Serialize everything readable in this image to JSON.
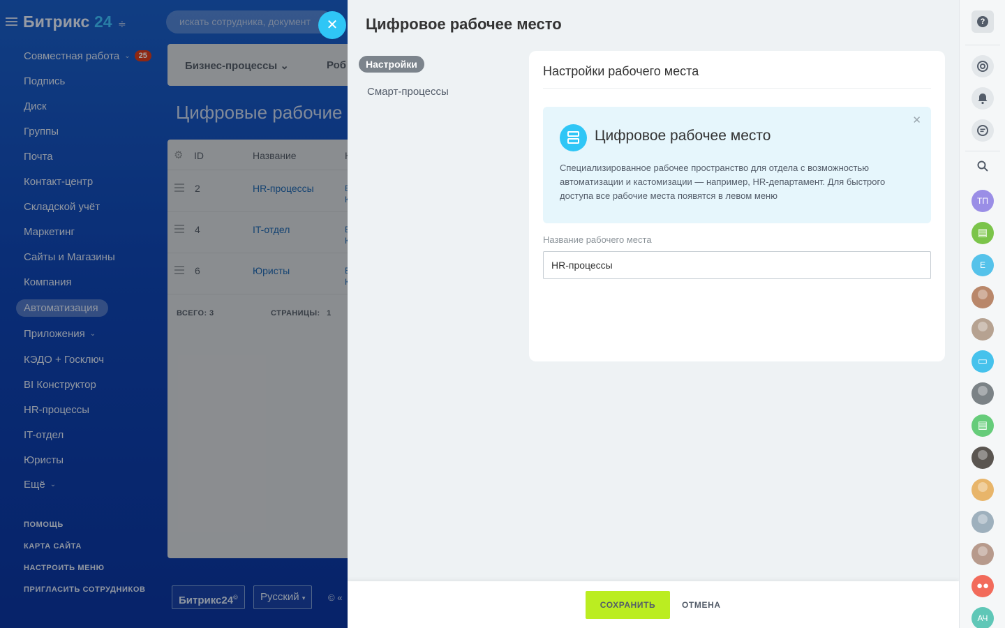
{
  "app": {
    "logo_text": "Битрикс",
    "logo_number": "24",
    "search_placeholder": "искать сотрудника, документ"
  },
  "sidebar": {
    "items": [
      {
        "label": "Совместная работа",
        "badge": "25",
        "chevron": true
      },
      {
        "label": "Подпись"
      },
      {
        "label": "Диск"
      },
      {
        "label": "Группы"
      },
      {
        "label": "Почта"
      },
      {
        "label": "Контакт-центр"
      },
      {
        "label": "Складской учёт"
      },
      {
        "label": "Маркетинг"
      },
      {
        "label": "Сайты и Магазины"
      },
      {
        "label": "Компания"
      },
      {
        "label": "Автоматизация",
        "active": true
      },
      {
        "label": "Приложения",
        "chevron": true
      },
      {
        "label": "КЭДО + Госключ"
      },
      {
        "label": "BI Конструктор"
      },
      {
        "label": "HR-процессы"
      },
      {
        "label": "IT-отдел"
      },
      {
        "label": "Юристы"
      },
      {
        "label": "Ещё",
        "chevron": true
      }
    ],
    "footer_links": [
      "ПОМОЩЬ",
      "КАРТА САЙТА",
      "НАСТРОИТЬ МЕНЮ",
      "ПРИГЛАСИТЬ СОТРУДНИКОВ"
    ]
  },
  "background_page": {
    "top_tabs": [
      "Бизнес-процессы",
      "Роб"
    ],
    "title": "Цифровые рабочие м",
    "table": {
      "headers": [
        "ID",
        "Название",
        "К"
      ],
      "rows": [
        {
          "id": "2",
          "name": "HR-процессы",
          "extra": "Е\nК"
        },
        {
          "id": "4",
          "name": "IT-отдел",
          "extra": "Е\nК"
        },
        {
          "id": "6",
          "name": "Юристы",
          "extra": "Е\nК"
        }
      ],
      "total_label": "ВСЕГО:",
      "total_value": "3",
      "pages_label": "СТРАНИЦЫ:",
      "pages_value": "1"
    },
    "footer_logo": "Битрикс24",
    "footer_lang": "Русский",
    "footer_copy": "© «"
  },
  "slider": {
    "title": "Цифровое рабочее место",
    "menu": [
      "Настройки",
      "Смарт-процессы"
    ],
    "card_title": "Настройки рабочего места",
    "info_title": "Цифровое рабочее место",
    "info_text": "Специализированное рабочее пространство для отдела с возможностью автоматизации и кастомизации — например, HR-департамент. Для быстрого доступа все рабочие места появятся в левом меню",
    "field_label": "Название рабочего места",
    "field_value": "HR-процессы",
    "save_label": "СОХРАНИТЬ",
    "cancel_label": "ОТМЕНА"
  },
  "right_panel": {
    "avatars": [
      {
        "initials": "ТП",
        "color": "#9a8ee6"
      },
      {
        "initials": "",
        "color": "#7bc44a",
        "icon": "contact-card-icon"
      },
      {
        "initials": "Е",
        "color": "#55c2ea"
      },
      {
        "initials": "",
        "color": "#b9876a"
      },
      {
        "initials": "",
        "color": "#b6a291"
      },
      {
        "initials": "",
        "color": "#46c2ec",
        "icon": "chat-icon"
      },
      {
        "initials": "",
        "color": "#7b8286"
      },
      {
        "initials": "",
        "color": "#66cc7a",
        "icon": "document-icon"
      },
      {
        "initials": "",
        "color": "#5a5550"
      },
      {
        "initials": "",
        "color": "#e8b56a"
      },
      {
        "initials": "",
        "color": "#9eb0bd"
      },
      {
        "initials": "",
        "color": "#b79a8c"
      },
      {
        "initials": "",
        "color": "#f26b5b",
        "icon": "group-icon"
      },
      {
        "initials": "АЧ",
        "color": "#5fc7b7"
      }
    ]
  }
}
